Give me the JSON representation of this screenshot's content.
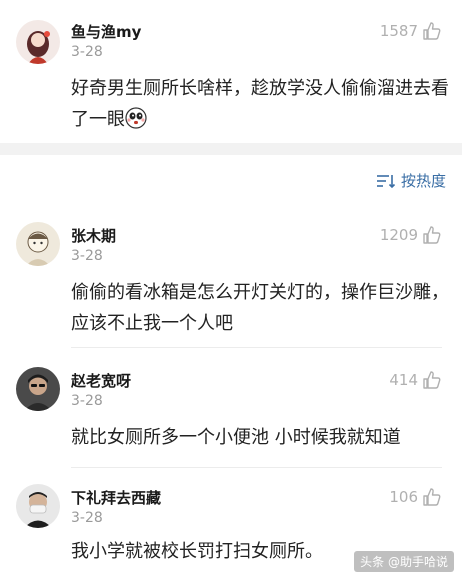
{
  "top_comment": {
    "username": "鱼与渔my",
    "date": "3-28",
    "likes": "1587",
    "text": "好奇男生厕所长啥样，趁放学没人偷偷溜进去看了一眼"
  },
  "sort": {
    "label": "按热度"
  },
  "comments": [
    {
      "username": "张木期",
      "date": "3-28",
      "likes": "1209",
      "text": "偷偷的看冰箱是怎么开灯关灯的，操作巨沙雕，应该不止我一个人吧"
    },
    {
      "username": "赵老宽呀",
      "date": "3-28",
      "likes": "414",
      "text": "就比女厕所多一个小便池 小时候我就知道"
    },
    {
      "username": "下礼拜去西藏",
      "date": "3-28",
      "likes": "106",
      "text": "我小学就被校长罚打扫女厕所。"
    }
  ],
  "watermark": "头条 @助手哈说",
  "colors": {
    "accent": "#3a6ea5",
    "muted": "#9a9a9a",
    "divider": "#ececec"
  }
}
